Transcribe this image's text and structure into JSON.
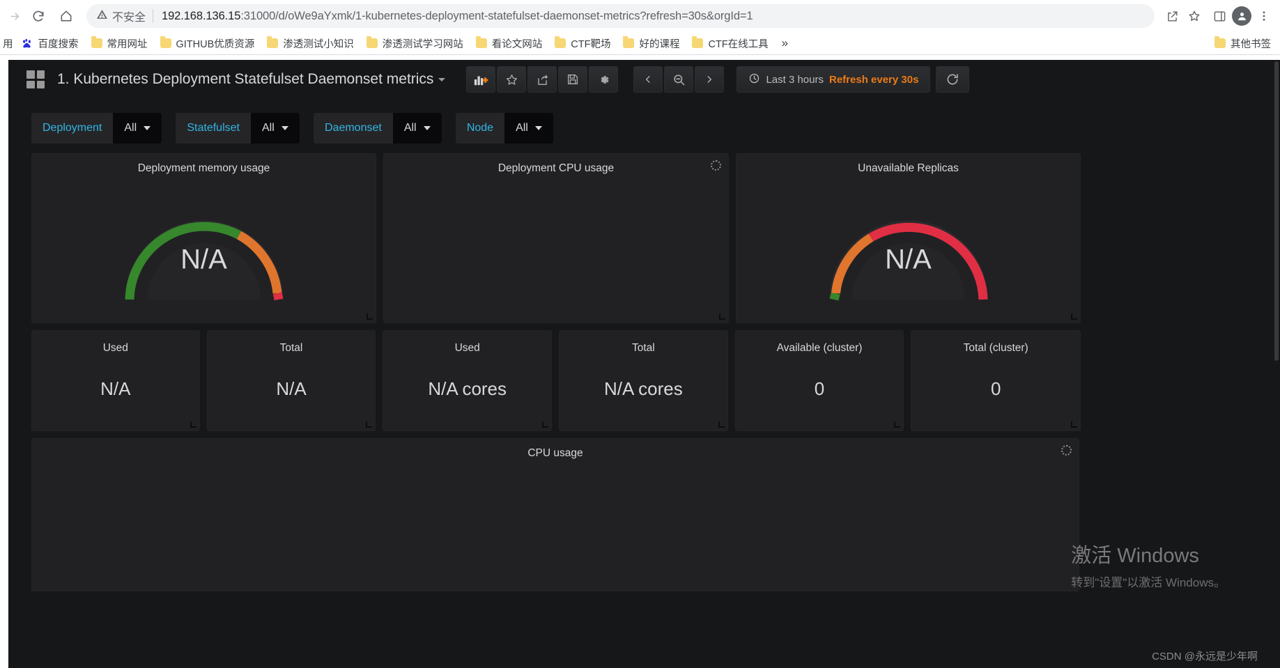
{
  "browser": {
    "nav": {
      "forward_icon": "arrow-forward-icon",
      "reload_icon": "reload-icon",
      "home_icon": "home-icon"
    },
    "omnibox": {
      "security_label": "不安全",
      "security_icon": "warning-triangle-icon",
      "url_host": "192.168.136.15",
      "url_rest": ":31000/d/oWe9aYxmk/1-kubernetes-deployment-statefulset-daemonset-metrics?refresh=30s&orgId=1",
      "full_url": "192.168.136.15:31000/d/oWe9aYxmk/1-kubernetes-deployment-statefulset-daemonset-metrics?refresh=30s&orgId=1",
      "share_icon": "share-icon",
      "bookmark_icon": "star-icon"
    },
    "right_icons": {
      "sidepanel_icon": "side-panel-icon",
      "profile_icon": "profile-avatar-icon",
      "menu_icon": "three-dot-menu-icon"
    },
    "bookmarks": {
      "clipped_first": "用",
      "items": [
        {
          "label": "百度搜索",
          "icon": "baidu-paw-icon"
        },
        {
          "label": "常用网址",
          "icon": "folder-icon"
        },
        {
          "label": "GITHUB优质资源",
          "icon": "folder-icon"
        },
        {
          "label": "渗透测试小知识",
          "icon": "folder-icon"
        },
        {
          "label": "渗透测试学习网站",
          "icon": "folder-icon"
        },
        {
          "label": "看论文网站",
          "icon": "folder-icon"
        },
        {
          "label": "CTF靶场",
          "icon": "folder-icon"
        },
        {
          "label": "好的课程",
          "icon": "folder-icon"
        },
        {
          "label": "CTF在线工具",
          "icon": "folder-icon"
        }
      ],
      "overflow_label": "»",
      "other_bookmarks": {
        "label": "其他书签",
        "icon": "folder-icon"
      }
    }
  },
  "grafana": {
    "navbar": {
      "dashboard_icon": "dashboard-grid-icon",
      "title": "1. Kubernetes Deployment Statefulset Daemonset metrics",
      "title_caret": "chevron-down-icon",
      "actions": [
        {
          "name": "add-panel-button",
          "icon": "add-panel-icon"
        },
        {
          "name": "star-dashboard-button",
          "icon": "star-icon"
        },
        {
          "name": "share-dashboard-button",
          "icon": "share-icon"
        },
        {
          "name": "save-dashboard-button",
          "icon": "save-floppy-icon"
        },
        {
          "name": "dashboard-settings-button",
          "icon": "gear-icon"
        }
      ],
      "time_nav": [
        {
          "name": "time-shift-back-button",
          "icon": "chevron-left-icon"
        },
        {
          "name": "zoom-out-button",
          "icon": "magnifier-minus-icon"
        },
        {
          "name": "time-shift-forward-button",
          "icon": "chevron-right-icon"
        }
      ],
      "time_range": "Last 3 hours",
      "time_icon": "clock-icon",
      "refresh_interval": "Refresh every 30s",
      "refresh_button_icon": "refresh-cycle-icon"
    },
    "variables": [
      {
        "label": "Deployment",
        "value": "All"
      },
      {
        "label": "Statefulset",
        "value": "All"
      },
      {
        "label": "Daemonset",
        "value": "All"
      },
      {
        "label": "Node",
        "value": "All"
      }
    ],
    "panels": {
      "gauges": [
        {
          "title": "Deployment memory usage",
          "value": "N/A",
          "colors": [
            "#37872d",
            "#e0752d",
            "#e02f44"
          ],
          "stops": [
            0.62,
            0.3,
            0.08
          ]
        },
        {
          "title": "Deployment CPU usage",
          "value": "",
          "loading": true
        },
        {
          "title": "Unavailable Replicas",
          "value": "N/A",
          "colors": [
            "#e02f44",
            "#e0752d",
            "#37872d"
          ],
          "stops": [
            0.55,
            0.4,
            0.05
          ]
        }
      ],
      "stats": [
        {
          "title": "Used",
          "value": "N/A"
        },
        {
          "title": "Total",
          "value": "N/A"
        },
        {
          "title": "Used",
          "value": "N/A cores"
        },
        {
          "title": "Total",
          "value": "N/A cores"
        },
        {
          "title": "Available (cluster)",
          "value": "0"
        },
        {
          "title": "Total (cluster)",
          "value": "0"
        }
      ],
      "cpu_usage": {
        "title": "CPU usage"
      }
    }
  },
  "watermark": {
    "line1": "激活 Windows",
    "line2": "转到\"设置\"以激活 Windows。"
  },
  "footer_credit": "CSDN @永远是少年啊"
}
